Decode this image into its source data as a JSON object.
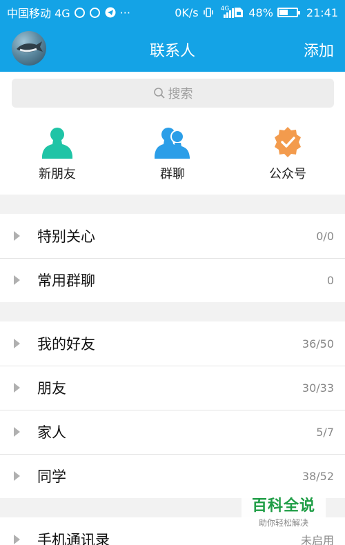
{
  "status_bar": {
    "carrier": "中国移动 4G",
    "more": "···",
    "speed": "0K/s",
    "net": "4G",
    "battery": "48%",
    "battery_level": 0.48,
    "time": "21:41"
  },
  "header": {
    "title": "联系人",
    "add_label": "添加"
  },
  "search": {
    "placeholder": "搜索"
  },
  "quick_actions": [
    {
      "label": "新朋友",
      "icon": "person-icon",
      "color": "#1fc4a6"
    },
    {
      "label": "群聊",
      "icon": "group-icon",
      "color": "#2b9ee8"
    },
    {
      "label": "公众号",
      "icon": "verified-badge-icon",
      "color": "#f39b4d"
    }
  ],
  "groups": [
    {
      "name": "特别关心",
      "count": "0/0"
    },
    {
      "name": "常用群聊",
      "count": "0"
    },
    {
      "name": "我的好友",
      "count": "36/50"
    },
    {
      "name": "朋友",
      "count": "30/33"
    },
    {
      "name": "家人",
      "count": "5/7"
    },
    {
      "name": "同学",
      "count": "38/52"
    },
    {
      "name": "手机通讯录",
      "count": "未启用"
    }
  ],
  "watermark": {
    "title": "百科全说",
    "subtitle": "助你轻松解决"
  }
}
